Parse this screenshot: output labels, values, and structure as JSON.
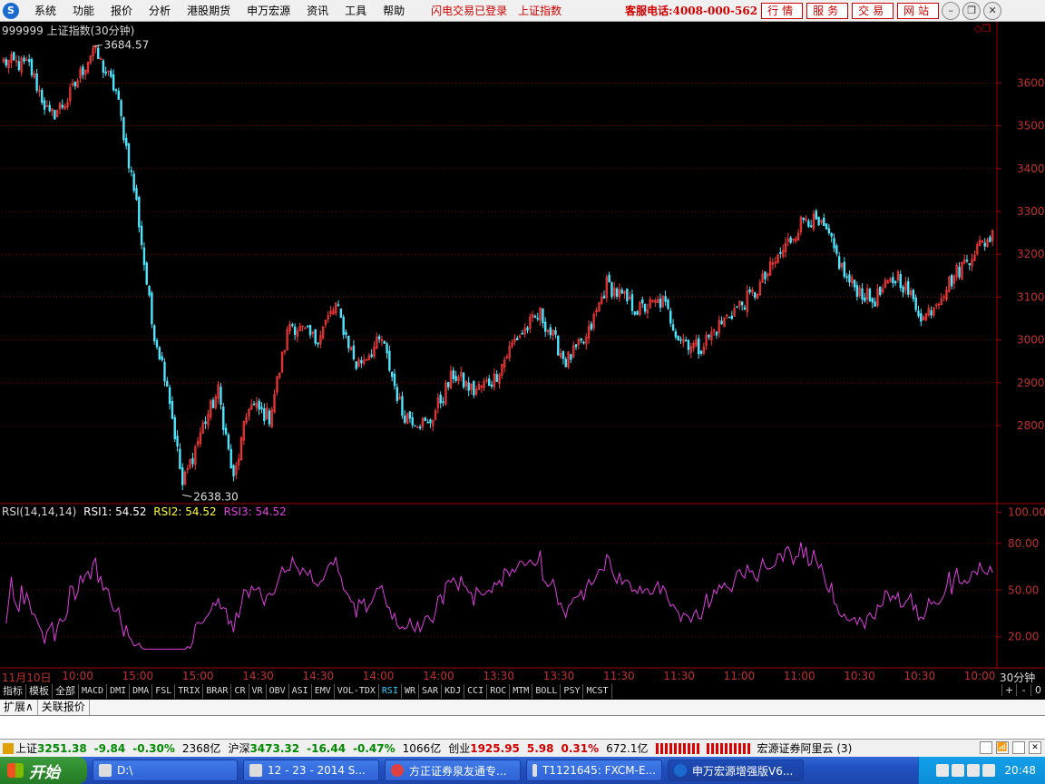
{
  "menubar": {
    "logo": "S",
    "items": [
      "系统",
      "功能",
      "报价",
      "分析",
      "港股期货",
      "申万宏源",
      "资讯",
      "工具",
      "帮助"
    ],
    "status1": "闪电交易已登录",
    "status2": "上证指数",
    "hotline": "客服电话:4008-000-562",
    "buttons": [
      "行情",
      "服务",
      "交易",
      "网站"
    ]
  },
  "symbol": {
    "label": "999999 上证指数(30分钟)",
    "high_label": "3684.57",
    "low_label": "2638.30"
  },
  "rsi": {
    "params": "RSI(14,14,14)",
    "rsi1": "RSI1: 54.52",
    "rsi2": "RSI2: 54.52",
    "rsi3": "RSI3: 54.52"
  },
  "colors": {
    "up": "#ff3b3b",
    "down": "#4ee6ff",
    "rsi": "#e040e0",
    "grid": "#a00000",
    "axis_text": "#c03030"
  },
  "time_axis": [
    "11月10日",
    "10:00",
    "15:00",
    "15:00",
    "14:30",
    "14:30",
    "14:00",
    "14:00",
    "13:30",
    "13:30",
    "11:30",
    "11:30",
    "11:00",
    "11:00",
    "10:30",
    "10:30",
    "10:00"
  ],
  "period": "30分钟",
  "tabs": [
    "指标",
    "模板",
    "全部",
    "MACD",
    "DMI",
    "DMA",
    "FSL",
    "TRIX",
    "BRAR",
    "CR",
    "VR",
    "OBV",
    "ASI",
    "EMV",
    "VOL-TDX",
    "RSI",
    "WR",
    "SAR",
    "KDJ",
    "CCI",
    "ROC",
    "MTM",
    "BOLL",
    "PSY",
    "MCST"
  ],
  "active_tab": "RSI",
  "tab_right": [
    "+",
    "-",
    "0"
  ],
  "subbar": [
    "扩展∧",
    "关联报价"
  ],
  "statusbar": {
    "sh_label": "上证",
    "sh_value": "3251.38",
    "sh_change": "-9.84",
    "sh_pct": "-0.30%",
    "sh_amount": "2368亿",
    "hs_label": "沪深",
    "hs_value": "3473.32",
    "hs_change": "-16.44",
    "hs_pct": "-0.47%",
    "hs_amount": "1066亿",
    "cy_label": "创业",
    "cy_value": "1925.95",
    "cy_change": "5.98",
    "cy_pct": "0.31%",
    "cy_amount": "672.1亿",
    "broker": "宏源证券阿里云 (3)"
  },
  "taskbar": {
    "start": "开始",
    "tasks": [
      "D:\\",
      "12 - 23 - 2014 S...",
      "方正证券泉友通专...",
      "T1121645: FXCM-E...",
      "申万宏源增强版V6..."
    ],
    "clock": "20:48"
  },
  "chart_data": [
    {
      "type": "candlestick",
      "title": "999999 上证指数(30分钟)",
      "y_ticks": [
        3600,
        3500,
        3400,
        3300,
        3200,
        3100,
        3000,
        2900,
        2800
      ],
      "ylim": [
        2620,
        3730
      ],
      "max_label": 3684.57,
      "min_label": 2638.3,
      "trend_points": [
        [
          0,
          3650
        ],
        [
          10,
          3640
        ],
        [
          18,
          3520
        ],
        [
          25,
          3560
        ],
        [
          35,
          3680
        ],
        [
          44,
          3580
        ],
        [
          52,
          3320
        ],
        [
          58,
          3040
        ],
        [
          64,
          2900
        ],
        [
          70,
          2660
        ],
        [
          78,
          2800
        ],
        [
          84,
          2880
        ],
        [
          90,
          2670
        ],
        [
          96,
          2850
        ],
        [
          104,
          2820
        ],
        [
          112,
          3040
        ],
        [
          122,
          3000
        ],
        [
          130,
          3080
        ],
        [
          138,
          2940
        ],
        [
          148,
          3000
        ],
        [
          156,
          2830
        ],
        [
          166,
          2800
        ],
        [
          176,
          2920
        ],
        [
          184,
          2880
        ],
        [
          192,
          2910
        ],
        [
          200,
          3000
        ],
        [
          210,
          3060
        ],
        [
          220,
          2950
        ],
        [
          228,
          3000
        ],
        [
          236,
          3130
        ],
        [
          248,
          3070
        ],
        [
          258,
          3090
        ],
        [
          264,
          3010
        ],
        [
          272,
          2980
        ],
        [
          284,
          3060
        ],
        [
          294,
          3110
        ],
        [
          304,
          3200
        ],
        [
          314,
          3290
        ],
        [
          322,
          3250
        ],
        [
          330,
          3140
        ],
        [
          340,
          3090
        ],
        [
          350,
          3150
        ],
        [
          360,
          3050
        ],
        [
          372,
          3150
        ],
        [
          380,
          3210
        ],
        [
          388,
          3250
        ]
      ],
      "candle_count": 388
    },
    {
      "type": "line",
      "title": "RSI(14,14,14)",
      "series": [
        {
          "name": "RSI1",
          "last": 54.52
        },
        {
          "name": "RSI2",
          "last": 54.52
        },
        {
          "name": "RSI3",
          "last": 54.52
        }
      ],
      "y_ticks": [
        100.0,
        80.0,
        50.0,
        20.0
      ],
      "ylim": [
        0,
        105
      ]
    }
  ]
}
